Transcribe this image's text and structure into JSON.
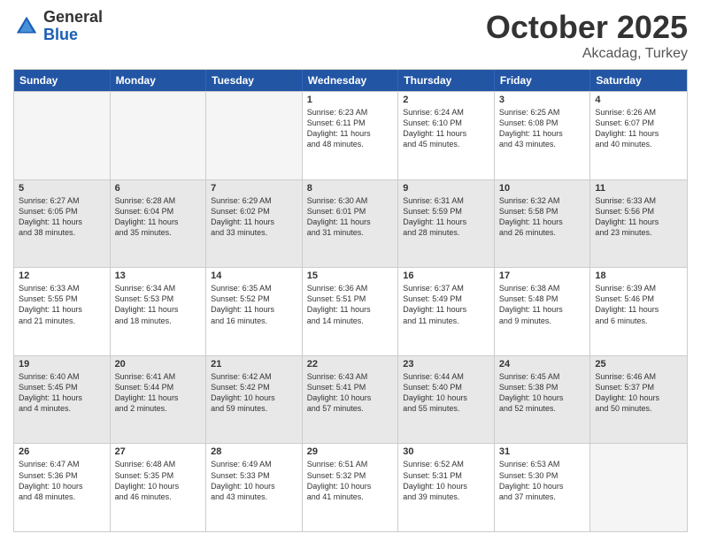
{
  "header": {
    "logo_general": "General",
    "logo_blue": "Blue",
    "month_title": "October 2025",
    "location": "Akcadag, Turkey"
  },
  "days_of_week": [
    "Sunday",
    "Monday",
    "Tuesday",
    "Wednesday",
    "Thursday",
    "Friday",
    "Saturday"
  ],
  "weeks": [
    [
      {
        "day": "",
        "text": "",
        "empty": true
      },
      {
        "day": "",
        "text": "",
        "empty": true
      },
      {
        "day": "",
        "text": "",
        "empty": true
      },
      {
        "day": "1",
        "text": "Sunrise: 6:23 AM\nSunset: 6:11 PM\nDaylight: 11 hours\nand 48 minutes."
      },
      {
        "day": "2",
        "text": "Sunrise: 6:24 AM\nSunset: 6:10 PM\nDaylight: 11 hours\nand 45 minutes."
      },
      {
        "day": "3",
        "text": "Sunrise: 6:25 AM\nSunset: 6:08 PM\nDaylight: 11 hours\nand 43 minutes."
      },
      {
        "day": "4",
        "text": "Sunrise: 6:26 AM\nSunset: 6:07 PM\nDaylight: 11 hours\nand 40 minutes."
      }
    ],
    [
      {
        "day": "5",
        "text": "Sunrise: 6:27 AM\nSunset: 6:05 PM\nDaylight: 11 hours\nand 38 minutes."
      },
      {
        "day": "6",
        "text": "Sunrise: 6:28 AM\nSunset: 6:04 PM\nDaylight: 11 hours\nand 35 minutes."
      },
      {
        "day": "7",
        "text": "Sunrise: 6:29 AM\nSunset: 6:02 PM\nDaylight: 11 hours\nand 33 minutes."
      },
      {
        "day": "8",
        "text": "Sunrise: 6:30 AM\nSunset: 6:01 PM\nDaylight: 11 hours\nand 31 minutes."
      },
      {
        "day": "9",
        "text": "Sunrise: 6:31 AM\nSunset: 5:59 PM\nDaylight: 11 hours\nand 28 minutes."
      },
      {
        "day": "10",
        "text": "Sunrise: 6:32 AM\nSunset: 5:58 PM\nDaylight: 11 hours\nand 26 minutes."
      },
      {
        "day": "11",
        "text": "Sunrise: 6:33 AM\nSunset: 5:56 PM\nDaylight: 11 hours\nand 23 minutes."
      }
    ],
    [
      {
        "day": "12",
        "text": "Sunrise: 6:33 AM\nSunset: 5:55 PM\nDaylight: 11 hours\nand 21 minutes."
      },
      {
        "day": "13",
        "text": "Sunrise: 6:34 AM\nSunset: 5:53 PM\nDaylight: 11 hours\nand 18 minutes."
      },
      {
        "day": "14",
        "text": "Sunrise: 6:35 AM\nSunset: 5:52 PM\nDaylight: 11 hours\nand 16 minutes."
      },
      {
        "day": "15",
        "text": "Sunrise: 6:36 AM\nSunset: 5:51 PM\nDaylight: 11 hours\nand 14 minutes."
      },
      {
        "day": "16",
        "text": "Sunrise: 6:37 AM\nSunset: 5:49 PM\nDaylight: 11 hours\nand 11 minutes."
      },
      {
        "day": "17",
        "text": "Sunrise: 6:38 AM\nSunset: 5:48 PM\nDaylight: 11 hours\nand 9 minutes."
      },
      {
        "day": "18",
        "text": "Sunrise: 6:39 AM\nSunset: 5:46 PM\nDaylight: 11 hours\nand 6 minutes."
      }
    ],
    [
      {
        "day": "19",
        "text": "Sunrise: 6:40 AM\nSunset: 5:45 PM\nDaylight: 11 hours\nand 4 minutes."
      },
      {
        "day": "20",
        "text": "Sunrise: 6:41 AM\nSunset: 5:44 PM\nDaylight: 11 hours\nand 2 minutes."
      },
      {
        "day": "21",
        "text": "Sunrise: 6:42 AM\nSunset: 5:42 PM\nDaylight: 10 hours\nand 59 minutes."
      },
      {
        "day": "22",
        "text": "Sunrise: 6:43 AM\nSunset: 5:41 PM\nDaylight: 10 hours\nand 57 minutes."
      },
      {
        "day": "23",
        "text": "Sunrise: 6:44 AM\nSunset: 5:40 PM\nDaylight: 10 hours\nand 55 minutes."
      },
      {
        "day": "24",
        "text": "Sunrise: 6:45 AM\nSunset: 5:38 PM\nDaylight: 10 hours\nand 52 minutes."
      },
      {
        "day": "25",
        "text": "Sunrise: 6:46 AM\nSunset: 5:37 PM\nDaylight: 10 hours\nand 50 minutes."
      }
    ],
    [
      {
        "day": "26",
        "text": "Sunrise: 6:47 AM\nSunset: 5:36 PM\nDaylight: 10 hours\nand 48 minutes."
      },
      {
        "day": "27",
        "text": "Sunrise: 6:48 AM\nSunset: 5:35 PM\nDaylight: 10 hours\nand 46 minutes."
      },
      {
        "day": "28",
        "text": "Sunrise: 6:49 AM\nSunset: 5:33 PM\nDaylight: 10 hours\nand 43 minutes."
      },
      {
        "day": "29",
        "text": "Sunrise: 6:51 AM\nSunset: 5:32 PM\nDaylight: 10 hours\nand 41 minutes."
      },
      {
        "day": "30",
        "text": "Sunrise: 6:52 AM\nSunset: 5:31 PM\nDaylight: 10 hours\nand 39 minutes."
      },
      {
        "day": "31",
        "text": "Sunrise: 6:53 AM\nSunset: 5:30 PM\nDaylight: 10 hours\nand 37 minutes."
      },
      {
        "day": "",
        "text": "",
        "empty": true
      }
    ]
  ]
}
